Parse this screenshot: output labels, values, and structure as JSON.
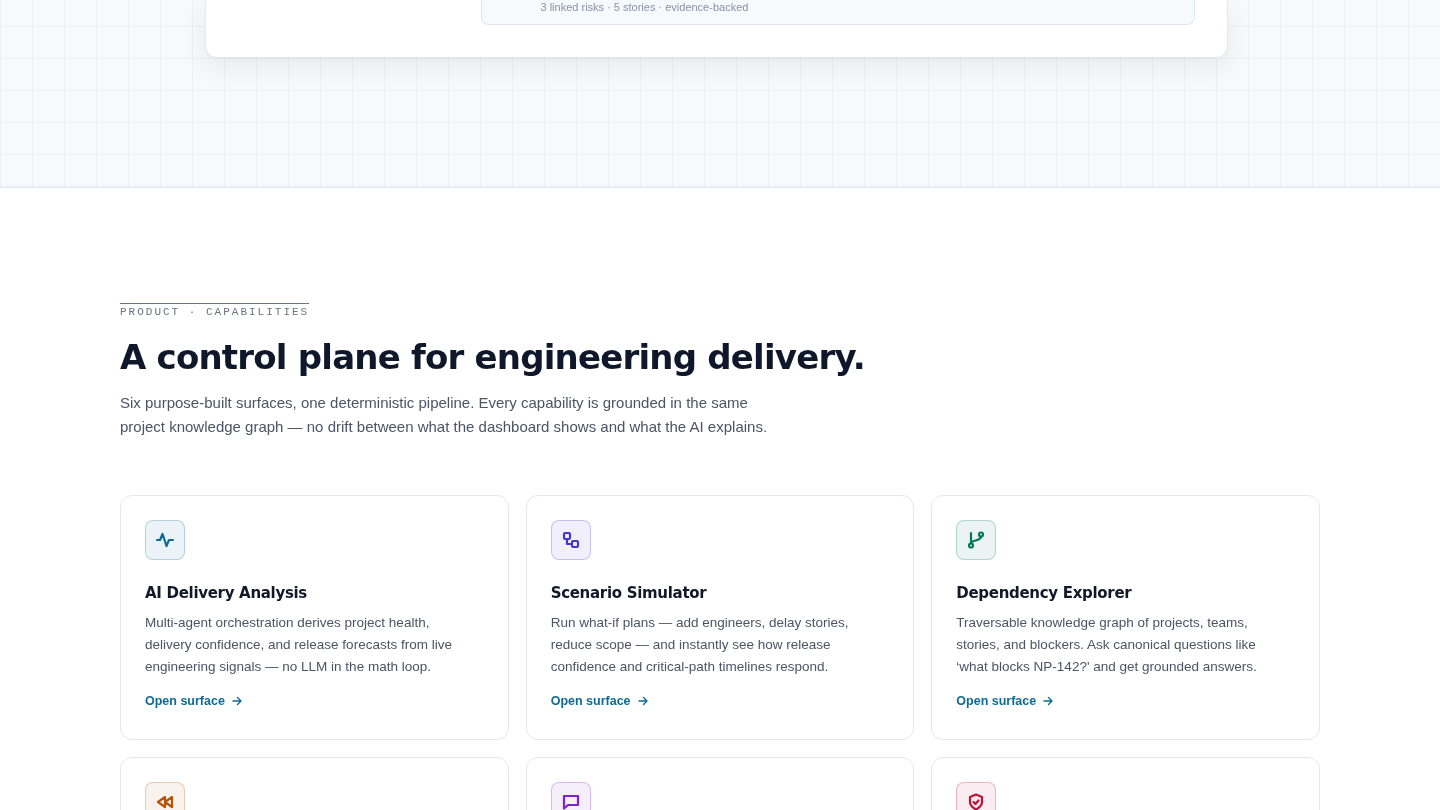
{
  "hero_preview": {
    "meta": "3 linked risks · 5 stories · evidence-backed"
  },
  "section": {
    "eyebrow": "PRODUCT · CAPABILITIES",
    "heading": "A control plane for engineering delivery.",
    "intro": "Six purpose-built surfaces, one deterministic pipeline. Every capability is grounded in the same project knowledge graph — no drift between what the dashboard shows and what the AI explains."
  },
  "cards": [
    {
      "kind": "pulse",
      "color": "#0e6b96",
      "title": "AI Delivery Analysis",
      "description": "Multi-agent orchestration derives project health, delivery confidence, and release forecasts from live engineering signals — no LLM in the math loop.",
      "link": "Open surface"
    },
    {
      "kind": "flow",
      "color": "#4338ca",
      "title": "Scenario Simulator",
      "description": "Run what-if plans — add engineers, delay stories, reduce scope — and instantly see how release confidence and critical-path timelines respond.",
      "link": "Open surface"
    },
    {
      "kind": "branch",
      "color": "#047857",
      "title": "Dependency Explorer",
      "description": "Traversable knowledge graph of projects, teams, stories, and blockers. Ask canonical questions like ‘what blocks NP-142?' and get grounded answers.",
      "link": "Open surface"
    },
    {
      "kind": "rewind",
      "color": "#b45309"
    },
    {
      "kind": "chat",
      "color": "#7e22ce"
    },
    {
      "kind": "shield",
      "color": "#be123c"
    }
  ]
}
